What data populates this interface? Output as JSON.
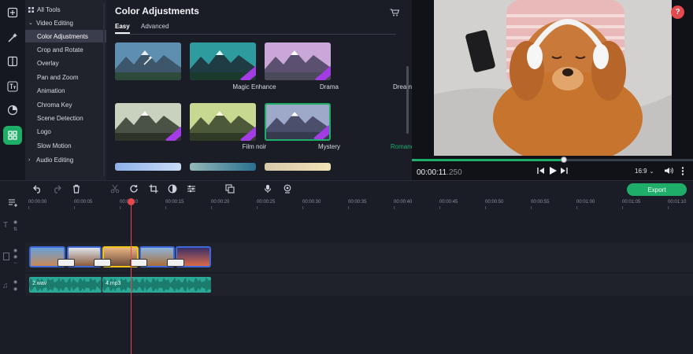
{
  "sidebar_icons": [
    "import-icon",
    "magic-wand-icon",
    "filters-icon",
    "titles-icon",
    "transitions-icon",
    "more-tools-icon"
  ],
  "tools": {
    "all_tools": "All Tools",
    "video_editing": "Video Editing",
    "items": [
      "Color Adjustments",
      "Crop and Rotate",
      "Overlay",
      "Pan and Zoom",
      "Animation",
      "Chroma Key",
      "Scene Detection",
      "Logo",
      "Slow Motion"
    ],
    "audio_editing": "Audio Editing",
    "selected_index": 0
  },
  "panel": {
    "title": "Color Adjustments",
    "tabs": [
      "Easy",
      "Advanced"
    ],
    "active_tab": 0,
    "presets": [
      {
        "name": "Magic Enhance",
        "badge": false
      },
      {
        "name": "Drama",
        "badge": true
      },
      {
        "name": "Dreamy",
        "badge": true
      },
      {
        "name": "Film noir",
        "badge": true
      },
      {
        "name": "Mystery",
        "badge": true
      },
      {
        "name": "Romance",
        "badge": true,
        "selected": true
      }
    ]
  },
  "preview": {
    "time_main": "00:00:11",
    "time_frac": ".250",
    "aspect": "16:9",
    "progress": 0.54,
    "help": "?"
  },
  "toolbar": {
    "export_label": "Export"
  },
  "ruler": [
    "00:00:00",
    "00:00:05",
    "00:00:10",
    "00:00:15",
    "00:00:20",
    "00:00:25",
    "00:00:30",
    "00:00:35",
    "00:00:40",
    "00:00:45",
    "00:00:50",
    "00:00:55",
    "00:01:00",
    "00:01:05",
    "00:01:10"
  ],
  "audio": [
    {
      "label": "2.wav"
    },
    {
      "label": "4.mp3"
    }
  ],
  "colors": {
    "accent": "#1fae6a",
    "playhead": "#e5484d",
    "audio": "#2aa996",
    "clip_border": "#3c68d8"
  }
}
